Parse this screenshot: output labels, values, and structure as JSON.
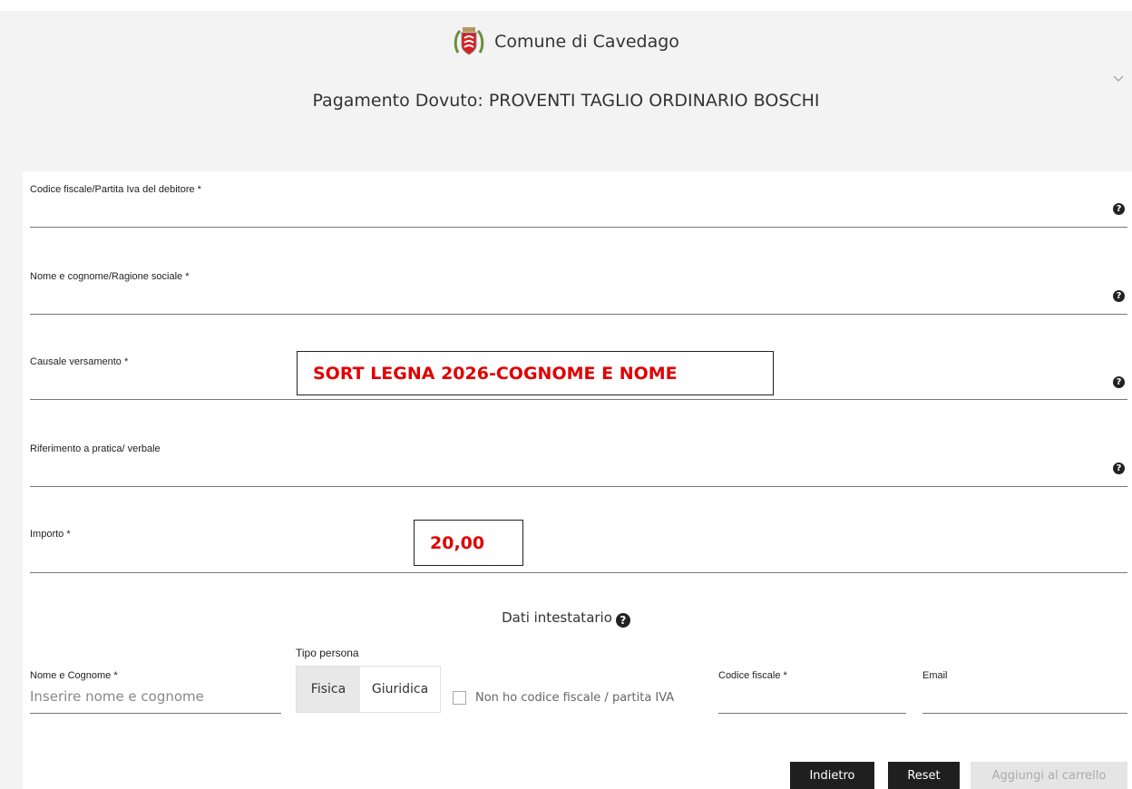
{
  "header": {
    "org_name": "Comune di Cavedago",
    "page_title": "Pagamento Dovuto: PROVENTI TAGLIO ORDINARIO BOSCHI"
  },
  "form": {
    "codice_fiscale_debitore": {
      "label": "Codice fiscale/Partita Iva del debitore *",
      "value": ""
    },
    "nome_cognome": {
      "label": "Nome e cognome/Ragione sociale *",
      "value": ""
    },
    "causale": {
      "label": "Causale versamento *",
      "value": "",
      "annotation": "SORT LEGNA 2026-COGNOME E NOME"
    },
    "riferimento": {
      "label": "Riferimento a pratica/ verbale",
      "value": ""
    },
    "importo": {
      "label": "Importo *",
      "value": "",
      "annotation": "20,00"
    }
  },
  "intestatario": {
    "title": "Dati intestatario",
    "nome_label": "Nome e Cognome *",
    "nome_placeholder": "Inserire nome e cognome",
    "tipo_persona_label": "Tipo persona",
    "tipo_options": [
      "Fisica",
      "Giuridica"
    ],
    "tipo_selected": "Fisica",
    "no_cf_label": "Non ho codice fiscale / partita IVA",
    "no_cf_checked": false,
    "codice_fiscale_label": "Codice fiscale *",
    "email_label": "Email"
  },
  "actions": {
    "back": "Indietro",
    "reset": "Reset",
    "add_to_cart": "Aggiungi al carrello"
  },
  "colors": {
    "annotation_text": "#e10000",
    "button_dark": "#1f1f1f",
    "button_disabled": "#e5e5e5"
  },
  "icons": {
    "help": "question-circle-icon",
    "chevron": "chevron-down-icon",
    "logo": "coat-of-arms-icon"
  }
}
